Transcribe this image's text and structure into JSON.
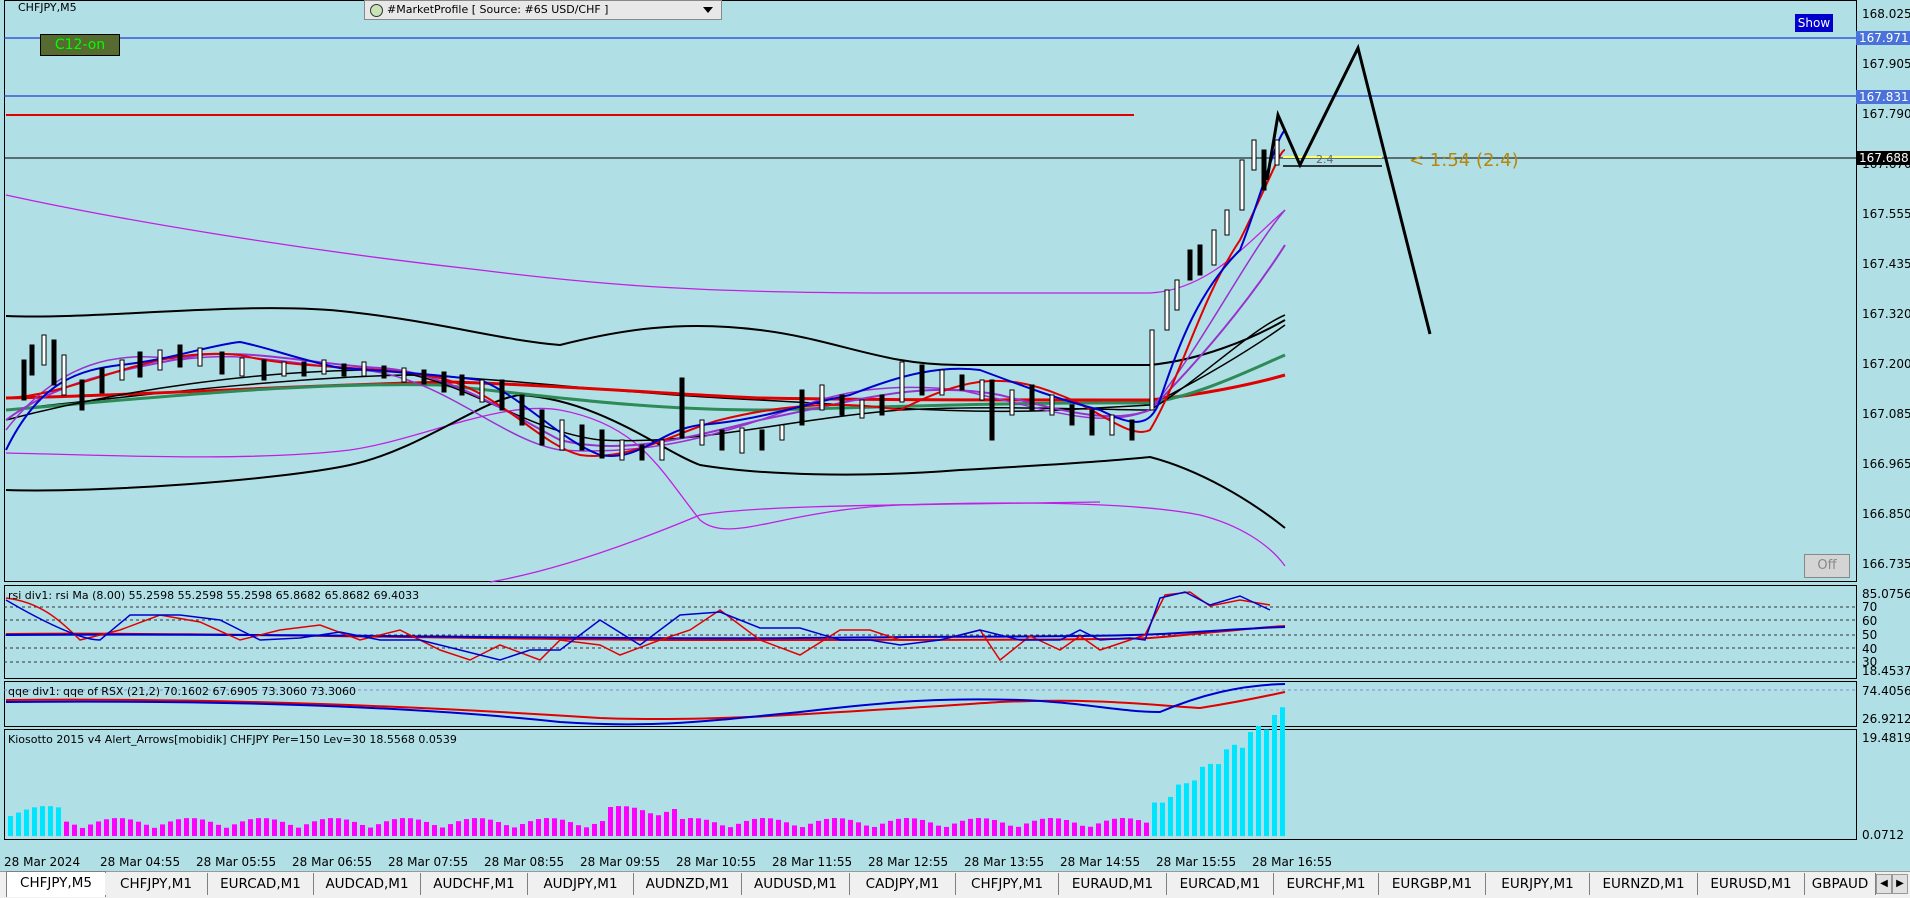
{
  "chart": {
    "symbol_label": "CHFJPY,M5",
    "c12_label": "C12-on",
    "market_profile_label": "#MarketProfile [ Source: #6S USD/CHF ]",
    "show_button": "Show",
    "off_button": "Off",
    "trade_label": "< 1:54 (2.4)",
    "trade_small": "2.4",
    "price_scale": [
      "168.025",
      "167.905",
      "167.790",
      "167.670",
      "167.555",
      "167.435",
      "167.320",
      "167.200",
      "167.085",
      "166.965",
      "166.850",
      "166.735"
    ],
    "price_highlights": [
      {
        "label": "167.971",
        "color": "#4a72d8"
      },
      {
        "label": "167.831",
        "color": "#4a72d8"
      },
      {
        "label": "167.688",
        "color": "#000000"
      }
    ],
    "time_labels": [
      "28 Mar 2024",
      "28 Mar 04:55",
      "28 Mar 05:55",
      "28 Mar 06:55",
      "28 Mar 07:55",
      "28 Mar 08:55",
      "28 Mar 09:55",
      "28 Mar 10:55",
      "28 Mar 11:55",
      "28 Mar 12:55",
      "28 Mar 13:55",
      "28 Mar 14:55",
      "28 Mar 15:55",
      "28 Mar 16:55"
    ]
  },
  "rsi": {
    "label": "rsi div1: rsi Ma (8.00) 55.2598 55.2598 55.2598 65.8682 65.8682 69.4033",
    "scale": [
      "85.0756",
      "70",
      "60",
      "50",
      "40",
      "30",
      "18.4537"
    ]
  },
  "qqe": {
    "label": "qqe div1: qqe of RSX (21,2) 70.1602 67.6905 73.3060 73.3060",
    "scale": [
      "74.4056",
      "26.9212"
    ]
  },
  "kiosotto": {
    "label": "Kiosotto 2015 v4 Alert_Arrows[mobidik] CHFJPY Per=150 Lev=30 18.5568 0.0539",
    "scale": [
      "19.4819",
      "0.0712"
    ]
  },
  "tabs": [
    "CHFJPY,M5",
    "CHFJPY,M1",
    "EURCAD,M1",
    "AUDCAD,M1",
    "AUDCHF,M1",
    "AUDJPY,M1",
    "AUDNZD,M1",
    "AUDUSD,M1",
    "CADJPY,M1",
    "CHFJPY,M1",
    "EURAUD,M1",
    "EURCAD,M1",
    "EURCHF,M1",
    "EURGBP,M1",
    "EURJPY,M1",
    "EURNZD,M1",
    "EURUSD,M1",
    "GBPAUD"
  ],
  "colors": {
    "background": "#b0e0e6",
    "bull_bar": "#00e5ff",
    "bear_bar": "#ff00ff",
    "accent": "#4a72d8"
  }
}
